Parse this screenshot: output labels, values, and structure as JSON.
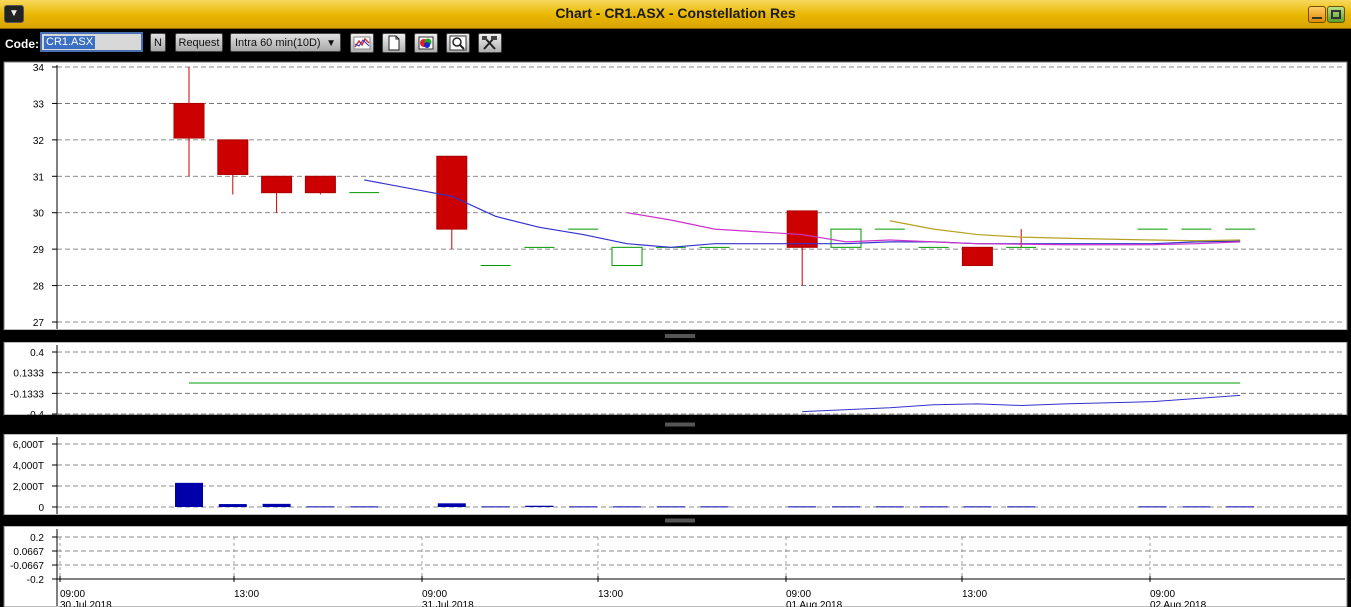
{
  "window": {
    "title": "Chart - CR1.ASX - Constellation Res"
  },
  "toolbar": {
    "code_label": "Code:",
    "code_value": "CR1.ASX",
    "n_label": "N",
    "request_label": "Request",
    "interval_value": "Intra 60 min(10D)"
  },
  "chart_data": [
    {
      "type": "candlestick",
      "panel": "price",
      "ylim": [
        27,
        34
      ],
      "yticks": [
        "34",
        "33",
        "32",
        "31",
        "30",
        "29",
        "28",
        "27"
      ],
      "candles": [
        {
          "o": 33.0,
          "h": 34.0,
          "l": 31.0,
          "c": 32.05
        },
        {
          "o": 32.0,
          "h": 32.0,
          "l": 30.5,
          "c": 31.05
        },
        {
          "o": 31.0,
          "h": 31.0,
          "l": 30.0,
          "c": 30.55
        },
        {
          "o": 31.0,
          "h": 31.0,
          "l": 30.5,
          "c": 30.55
        },
        {
          "o": 30.55,
          "h": 30.55,
          "l": 30.55,
          "c": 30.55
        },
        null,
        {
          "o": 31.55,
          "h": 31.55,
          "l": 29.0,
          "c": 29.55
        },
        {
          "o": 28.55,
          "h": 28.55,
          "l": 28.55,
          "c": 28.55
        },
        {
          "o": 29.05,
          "h": 29.05,
          "l": 29.05,
          "c": 29.05
        },
        {
          "o": 29.55,
          "h": 29.55,
          "l": 29.55,
          "c": 29.55
        },
        {
          "o": 28.55,
          "h": 29.05,
          "l": 28.55,
          "c": 29.05
        },
        {
          "o": 29.05,
          "h": 29.05,
          "l": 29.05,
          "c": 29.05
        },
        {
          "o": 29.05,
          "h": 29.05,
          "l": 29.05,
          "c": 29.05
        },
        null,
        {
          "o": 30.05,
          "h": 30.05,
          "l": 28.0,
          "c": 29.05
        },
        {
          "o": 29.05,
          "h": 29.55,
          "l": 29.05,
          "c": 29.55
        },
        {
          "o": 29.55,
          "h": 29.55,
          "l": 29.55,
          "c": 29.55
        },
        {
          "o": 29.05,
          "h": 29.05,
          "l": 29.05,
          "c": 29.05
        },
        {
          "o": 29.05,
          "h": 29.05,
          "l": 28.55,
          "c": 28.55
        },
        {
          "o": 29.05,
          "h": 29.55,
          "l": 29.05,
          "c": 29.05
        },
        null,
        null,
        {
          "o": 29.55,
          "h": 29.55,
          "l": 29.55,
          "c": 29.55
        },
        {
          "o": 29.55,
          "h": 29.55,
          "l": 29.55,
          "c": 29.55
        },
        {
          "o": 29.55,
          "h": 29.55,
          "l": 29.55,
          "c": 29.55
        }
      ],
      "moving_averages": [
        {
          "color": "#3333cc",
          "points": [
            [
              4,
              30.9
            ],
            [
              6,
              30.45
            ],
            [
              7,
              29.9
            ],
            [
              8,
              29.6
            ],
            [
              9,
              29.4
            ],
            [
              10,
              29.15
            ],
            [
              11,
              29.05
            ],
            [
              12,
              29.15
            ],
            [
              14,
              29.15
            ],
            [
              15,
              29.15
            ],
            [
              16,
              29.2
            ],
            [
              17,
              29.2
            ],
            [
              18,
              29.15
            ],
            [
              20,
              29.15
            ],
            [
              22,
              29.15
            ],
            [
              23,
              29.2
            ],
            [
              24,
              29.22
            ]
          ]
        },
        {
          "color": "#cc33cc",
          "points": [
            [
              10,
              30.0
            ],
            [
              11,
              29.8
            ],
            [
              12,
              29.55
            ],
            [
              14,
              29.4
            ],
            [
              15,
              29.2
            ],
            [
              16,
              29.25
            ],
            [
              17,
              29.2
            ],
            [
              18,
              29.15
            ],
            [
              20,
              29.12
            ],
            [
              22,
              29.12
            ],
            [
              23,
              29.15
            ],
            [
              24,
              29.2
            ]
          ]
        },
        {
          "color": "#b8a020",
          "points": [
            [
              16,
              29.78
            ],
            [
              17,
              29.55
            ],
            [
              18,
              29.4
            ],
            [
              19,
              29.33
            ],
            [
              20,
              29.3
            ],
            [
              22,
              29.25
            ],
            [
              23,
              29.23
            ],
            [
              24,
              29.25
            ]
          ]
        }
      ]
    },
    {
      "type": "line",
      "panel": "indicator-1",
      "ylim": [
        -0.4,
        0.4
      ],
      "yticks": [
        "0.4",
        "0.1333",
        "-0.1333",
        "-0.4"
      ],
      "series": [
        {
          "color": "#009900",
          "points": [
            [
              0,
              0.0
            ],
            [
              24,
              0.0
            ]
          ]
        },
        {
          "color": "#3333cc",
          "points": [
            [
              14,
              -0.37
            ],
            [
              16,
              -0.32
            ],
            [
              17,
              -0.28
            ],
            [
              18,
              -0.27
            ],
            [
              19,
              -0.29
            ],
            [
              20,
              -0.27
            ],
            [
              22,
              -0.24
            ],
            [
              23,
              -0.2
            ],
            [
              24,
              -0.16
            ]
          ]
        }
      ]
    },
    {
      "type": "bar",
      "panel": "volume",
      "ylim": [
        0,
        6000
      ],
      "yticks": [
        "6,000T",
        "4,000T",
        "2,000T",
        "0"
      ],
      "values": [
        2300,
        280,
        300,
        60,
        60,
        null,
        350,
        60,
        120,
        60,
        60,
        60,
        60,
        null,
        60,
        60,
        60,
        60,
        60,
        60,
        null,
        null,
        60,
        60,
        60
      ]
    },
    {
      "type": "line",
      "panel": "indicator-2",
      "ylim": [
        -0.2,
        0.2
      ],
      "yticks": [
        "0.2",
        "0.0667",
        "-0.0667",
        "-0.2"
      ],
      "x_ticks": [
        {
          "label": "09:00",
          "sublabel": "30 Jul 2018"
        },
        {
          "label": "13:00",
          "sublabel": ""
        },
        {
          "label": "09:00",
          "sublabel": "31 Jul 2018"
        },
        {
          "label": "13:00",
          "sublabel": ""
        },
        {
          "label": "09:00",
          "sublabel": "01 Aug 2018"
        },
        {
          "label": "13:00",
          "sublabel": ""
        },
        {
          "label": "09:00",
          "sublabel": "02 Aug 2018"
        }
      ]
    }
  ]
}
